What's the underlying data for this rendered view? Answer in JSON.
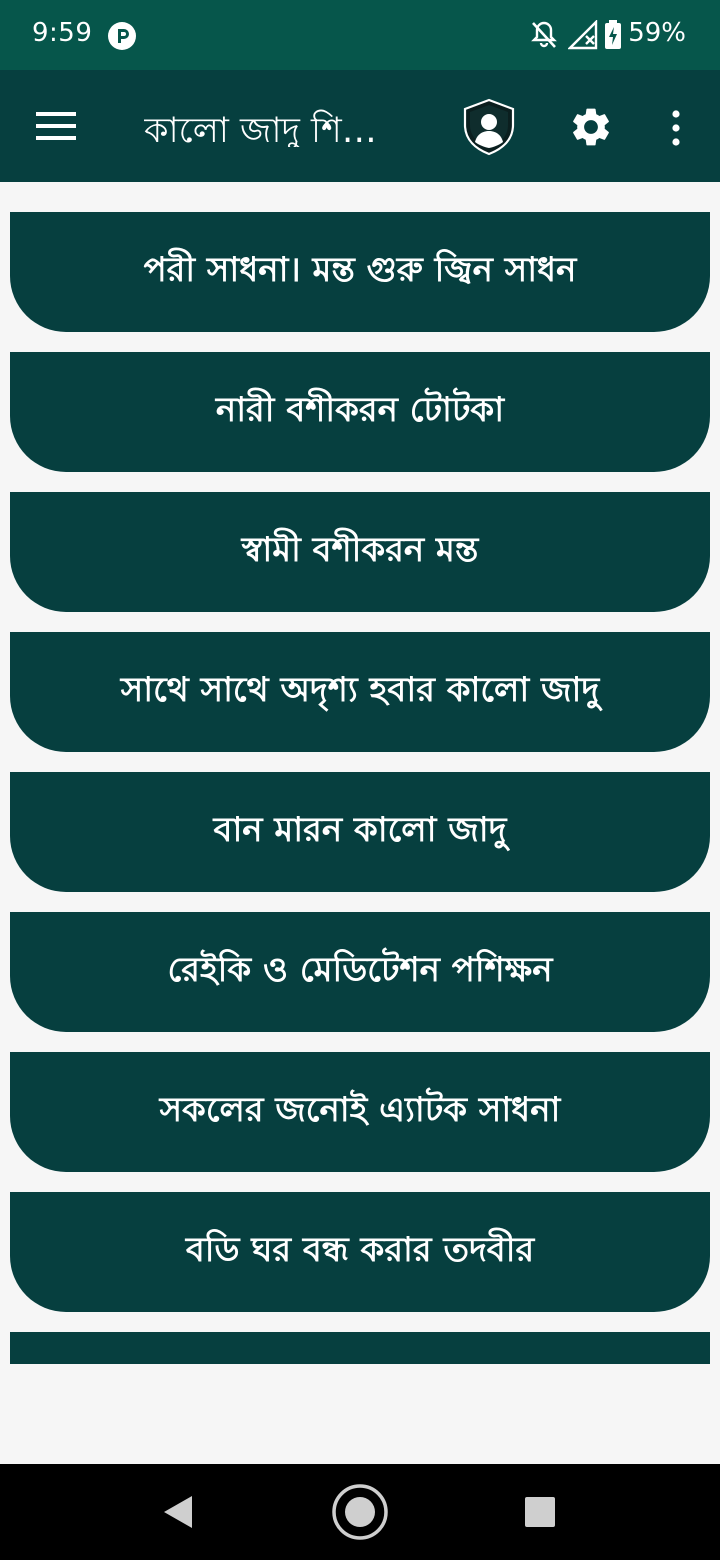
{
  "status_bar": {
    "time": "9:59",
    "battery_percent": "59%",
    "icons": [
      "app-notification-icon",
      "notifications-off-icon",
      "signal-icon",
      "battery-icon"
    ]
  },
  "app_bar": {
    "title": "কালো জাদু শি…",
    "icons": [
      "menu-icon",
      "shield-user-icon",
      "gear-icon",
      "more-vert-icon"
    ]
  },
  "menu_items": [
    {
      "label": "পরী সাধনা। মন্ত গুরু জ্বিন সাধন"
    },
    {
      "label": "নারী বশীকরন টোটকা"
    },
    {
      "label": "স্বামী বশীকরন মন্ত"
    },
    {
      "label": "সাথে সাথে অদৃশ্য হবার কালো জাদু"
    },
    {
      "label": "বান মারন কালো জাদু"
    },
    {
      "label": "রেইকি ও মেডিটেশন পশিক্ষন"
    },
    {
      "label": "সকলের জনোই এ্যাটক সাধনা"
    },
    {
      "label": "বডি ঘর বন্ধ করার তদবীর"
    }
  ],
  "nav_bar": {
    "icons": [
      "back-icon",
      "home-icon",
      "recents-icon"
    ]
  },
  "colors": {
    "status_bar": "#06564b",
    "app_bar": "#063f3f",
    "button": "#063f3f",
    "background": "#f6f6f6",
    "text": "#ffffff"
  }
}
